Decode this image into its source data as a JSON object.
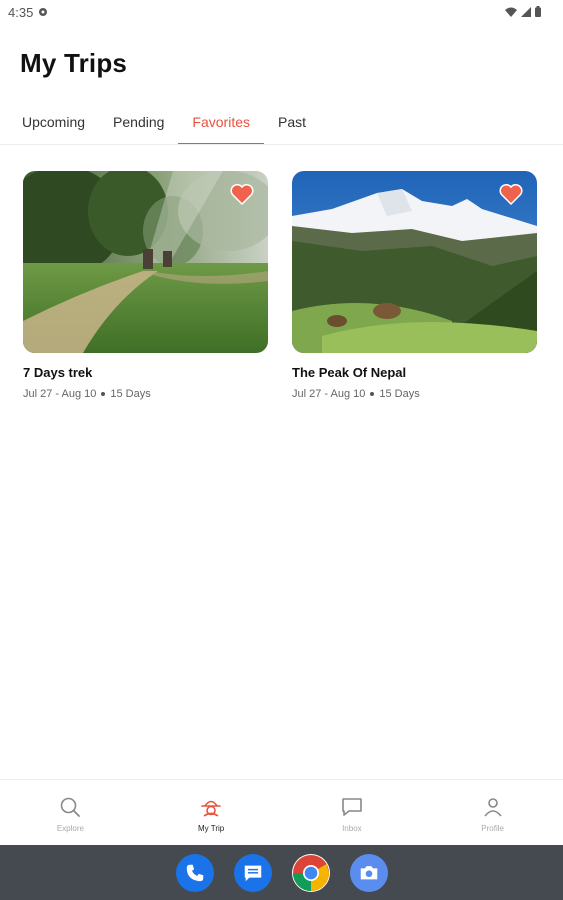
{
  "status_bar": {
    "time": "4:35"
  },
  "page_title": "My Trips",
  "tabs": [
    {
      "label": "Upcoming",
      "active": false
    },
    {
      "label": "Pending",
      "active": false
    },
    {
      "label": "Favorites",
      "active": true
    },
    {
      "label": "Past",
      "active": false
    }
  ],
  "trips": [
    {
      "title": "7 Days trek",
      "dates": "Jul 27 - Aug 10",
      "duration": "15 Days",
      "favorite": true
    },
    {
      "title": "The Peak Of Nepal",
      "dates": "Jul 27 - Aug 10",
      "duration": "15 Days",
      "favorite": true
    }
  ],
  "bottom_nav": [
    {
      "label": "Explore",
      "icon": "search-icon",
      "active": false
    },
    {
      "label": "My Trip",
      "icon": "trip-icon",
      "active": true
    },
    {
      "label": "Inbox",
      "icon": "chat-icon",
      "active": false
    },
    {
      "label": "Profile",
      "icon": "person-icon",
      "active": false
    }
  ],
  "dock_apps": [
    "phone-icon",
    "messages-icon",
    "chrome-icon",
    "camera-icon"
  ],
  "colors": {
    "accent": "#e8533d",
    "heart": "#f0624d",
    "dock": "#444a50"
  }
}
